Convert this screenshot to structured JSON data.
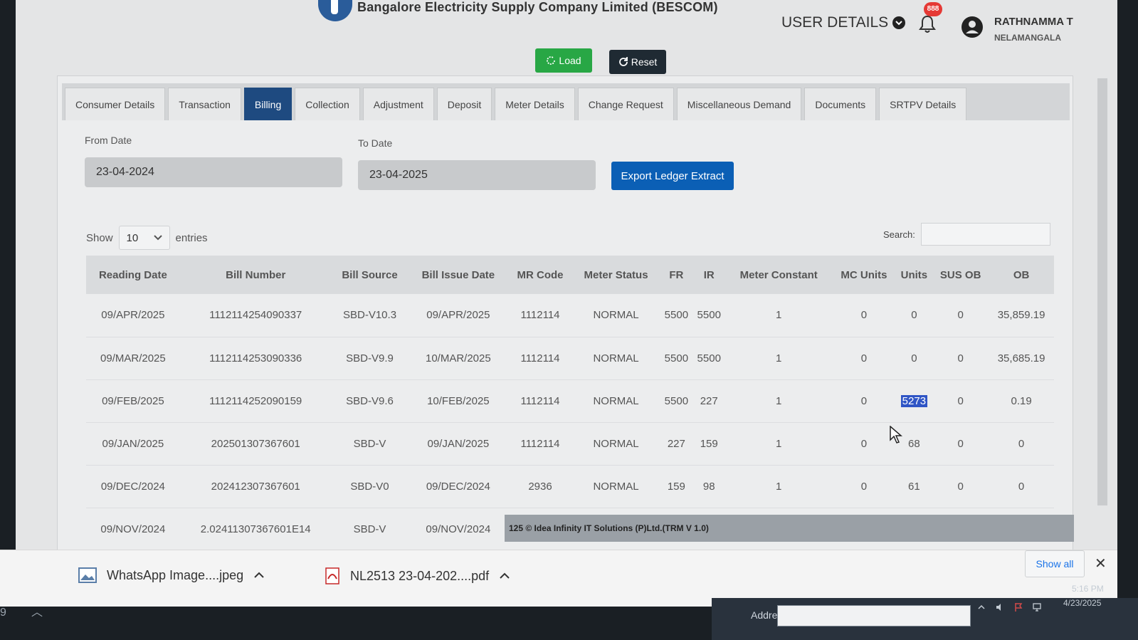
{
  "header": {
    "company": "Bangalore Electricity Supply Company Limited (BESCOM)",
    "user_details_label": "USER DETAILS",
    "notification_count": "888",
    "user_name": "RATHNAMMA T",
    "user_location": "NELAMANGALA"
  },
  "actions": {
    "load_label": "Load",
    "reset_label": "Reset"
  },
  "tabs": [
    {
      "label": "Consumer Details"
    },
    {
      "label": "Transaction"
    },
    {
      "label": "Billing",
      "active": true
    },
    {
      "label": "Collection"
    },
    {
      "label": "Adjustment"
    },
    {
      "label": "Deposit"
    },
    {
      "label": "Meter Details"
    },
    {
      "label": "Change Request"
    },
    {
      "label": "Miscellaneous Demand"
    },
    {
      "label": "Documents"
    },
    {
      "label": "SRTPV Details"
    }
  ],
  "filters": {
    "from_label": "From Date",
    "from_value": "23-04-2024",
    "to_label": "To Date",
    "to_value": "23-04-2025",
    "export_label": "Export Ledger Extract"
  },
  "table_controls": {
    "show_label": "Show",
    "entries_value": "10",
    "entries_label": "entries",
    "search_label": "Search:"
  },
  "table": {
    "columns": [
      "Reading Date",
      "Bill Number",
      "Bill Source",
      "Bill Issue Date",
      "MR Code",
      "Meter Status",
      "FR",
      "IR",
      "Meter Constant",
      "MC Units",
      "Units",
      "SUS OB",
      "OB"
    ],
    "rows": [
      [
        "09/APR/2025",
        "1112114254090337",
        "SBD-V10.3",
        "09/APR/2025",
        "1112114",
        "NORMAL",
        "5500",
        "5500",
        "1",
        "0",
        "0",
        "0",
        "35,859.19"
      ],
      [
        "09/MAR/2025",
        "1112114253090336",
        "SBD-V9.9",
        "10/MAR/2025",
        "1112114",
        "NORMAL",
        "5500",
        "5500",
        "1",
        "0",
        "0",
        "0",
        "35,685.19"
      ],
      [
        "09/FEB/2025",
        "1112114252090159",
        "SBD-V9.6",
        "10/FEB/2025",
        "1112114",
        "NORMAL",
        "5500",
        "227",
        "1",
        "0",
        "5273",
        "0",
        "0.19"
      ],
      [
        "09/JAN/2025",
        "202501307367601",
        "SBD-V",
        "09/JAN/2025",
        "1112114",
        "NORMAL",
        "227",
        "159",
        "1",
        "0",
        "68",
        "0",
        "0"
      ],
      [
        "09/DEC/2024",
        "202412307367601",
        "SBD-V0",
        "09/DEC/2024",
        "2936",
        "NORMAL",
        "159",
        "98",
        "1",
        "0",
        "61",
        "0",
        "0"
      ],
      [
        "09/NOV/2024",
        "2.02411307367601E14",
        "SBD-V",
        "09/NOV/2024",
        "",
        "",
        "",
        "",
        "",
        "",
        "",
        "",
        ""
      ]
    ]
  },
  "footer_text": "125 © Idea Infinity IT Solutions (P)Ltd.(TRM V 1.0)",
  "downloads": {
    "item1": "WhatsApp Image....jpeg",
    "item2": "NL2513 23-04-202....pdf",
    "show_all": "Show all"
  },
  "taskbar": {
    "edge_text": "9",
    "address_label": "Address",
    "time": "5:16 PM",
    "date": "4/23/2025"
  },
  "colors": {
    "active_tab": "#1e4a80",
    "load": "#28a745",
    "export": "#0b5fb5",
    "badge": "#e53935"
  }
}
